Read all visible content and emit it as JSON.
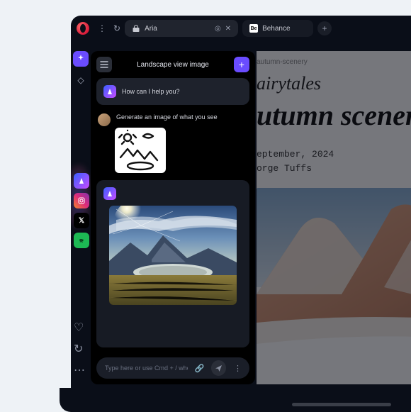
{
  "tabs": {
    "active": {
      "label": "Aria"
    },
    "inactive": {
      "favicon": "Be",
      "label": "Behance"
    }
  },
  "sidepanel": {
    "title": "Landscape view image",
    "greeting": "How can I help you?",
    "user_prompt": "Generate an image of what you see",
    "input_placeholder": "Type here or use Cmd + / when browsing"
  },
  "page": {
    "breadcrumb": "autumn-scenery",
    "heading_small": "airytales",
    "heading_large": "utumn scenery",
    "date": "eptember, 2024",
    "author": "orge Tuffs"
  }
}
